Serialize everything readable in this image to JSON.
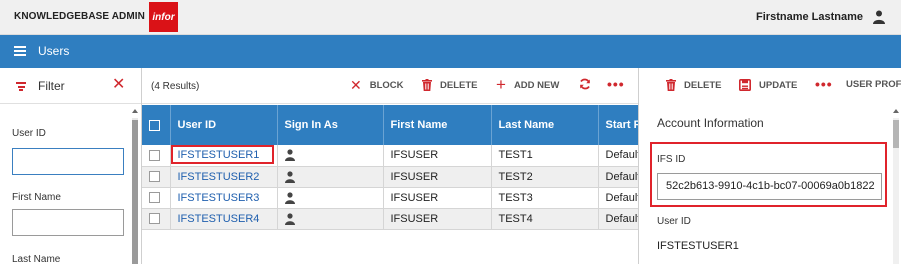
{
  "header": {
    "app_switcher": "KNOWLEDGEBASE ADMIN",
    "logo_text": "infor",
    "user_name": "Firstname Lastname"
  },
  "nav": {
    "page_title": "Users"
  },
  "filter": {
    "title": "Filter",
    "fields": [
      {
        "label": "User ID",
        "value": ""
      },
      {
        "label": "First Name",
        "value": ""
      },
      {
        "label": "Last Name",
        "value": ""
      }
    ]
  },
  "users_grid": {
    "results_count": "(4 Results)",
    "toolbar": {
      "block": "BLOCK",
      "delete": "DELETE",
      "add_new": "ADD NEW"
    },
    "columns": [
      "User ID",
      "Sign In As",
      "First Name",
      "Last Name",
      "Start P"
    ],
    "rows": [
      {
        "user_id": "IFSTESTUSER1",
        "first_name": "IFSUSER",
        "last_name": "TEST1",
        "start": "Default"
      },
      {
        "user_id": "IFSTESTUSER2",
        "first_name": "IFSUSER",
        "last_name": "TEST2",
        "start": "Default"
      },
      {
        "user_id": "IFSTESTUSER3",
        "first_name": "IFSUSER",
        "last_name": "TEST3",
        "start": "Default"
      },
      {
        "user_id": "IFSTESTUSER4",
        "first_name": "IFSUSER",
        "last_name": "TEST4",
        "start": "Default"
      }
    ]
  },
  "detail": {
    "toolbar": {
      "delete": "DELETE",
      "update": "UPDATE",
      "user_profile": "USER PROF"
    },
    "section_title": "Account Information",
    "ifs_id_label": "IFS ID",
    "ifs_id_value": "52c2b613-9910-4c1b-bc07-00069a0b1822",
    "user_id_label": "User ID",
    "user_id_value": "IFSTESTUSER1"
  },
  "colors": {
    "brand_red": "#da1217",
    "header_blue": "#2f7ec0",
    "highlight_red": "#e0232b",
    "link_blue": "#1f5fae"
  }
}
